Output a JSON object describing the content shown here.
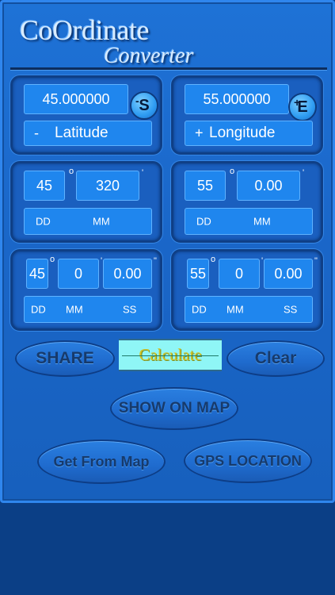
{
  "header": {
    "title_line1": "CoOrdinate",
    "title_line2": "Converter"
  },
  "decimal": {
    "latitude_value": "45.000000",
    "latitude_hemisphere": "S",
    "latitude_sign": "-",
    "latitude_label": "Latitude",
    "longitude_value": "55.000000",
    "longitude_hemisphere": "E",
    "longitude_sign": "+",
    "longitude_label": "Longitude",
    "badge_minus": "-",
    "badge_plus": "+"
  },
  "ddmm": {
    "lat_dd": "45",
    "lat_mm": "320",
    "lon_dd": "55",
    "lon_mm": "0.00",
    "deg_symbol": "o",
    "min_symbol": "'",
    "label_dd": "DD",
    "label_mm": "MM"
  },
  "ddmmss": {
    "lat_dd": "45",
    "lat_mm": "0",
    "lat_ss": "0.00",
    "lon_dd": "55",
    "lon_mm": "0",
    "lon_ss": "0.00",
    "deg_symbol": "o",
    "min_symbol": "'",
    "sec_symbol": "\"",
    "label_dd": "DD",
    "label_mm": "MM",
    "label_ss": "SS"
  },
  "buttons": {
    "share": "SHARE",
    "calculate": "Calculate",
    "clear": "Clear",
    "show_on_map": "SHOW ON MAP",
    "get_from_map": "Get From Map",
    "gps_location": "GPS LOCATION"
  },
  "colors": {
    "background": "#0b3f86",
    "panel": "#1a5fbf",
    "field": "#1f86ee",
    "calculate_bg": "#8ff6f6",
    "calculate_text": "#d4c21f"
  }
}
